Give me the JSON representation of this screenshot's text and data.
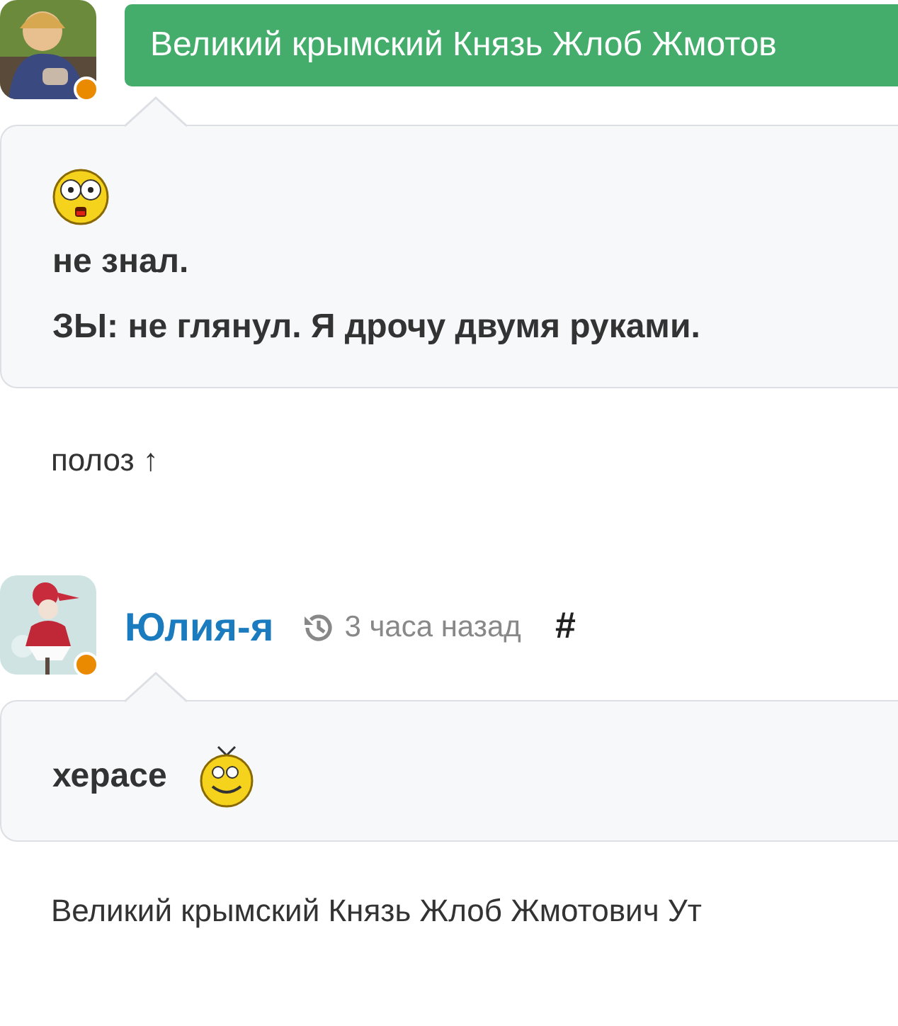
{
  "posts": [
    {
      "avatar": {
        "kind": "picture",
        "online": true
      },
      "author": {
        "kind": "badge",
        "name": "Великий крымский Князь Жлоб Жмотов"
      },
      "lines": [
        {
          "parts": [
            {
              "kind": "shocked-smiley"
            }
          ]
        },
        {
          "parts": [
            {
              "kind": "text",
              "text": "не знал."
            }
          ]
        },
        {
          "parts": [
            {
              "kind": "text",
              "text": "ЗЫ: не глянул. Я дрочу двумя руками."
            }
          ]
        }
      ],
      "footer": "полоз ↑"
    },
    {
      "avatar": {
        "kind": "picture",
        "online": true
      },
      "author": {
        "kind": "link",
        "name": "Юлия-я",
        "time": "3 часа назад",
        "anchor": "#"
      },
      "lines": [
        {
          "parts": [
            {
              "kind": "text",
              "text": "херасе"
            },
            {
              "kind": "happy-smiley"
            }
          ]
        }
      ],
      "footer": "Великий крымский Князь Жлоб Жмотович Ут"
    }
  ]
}
